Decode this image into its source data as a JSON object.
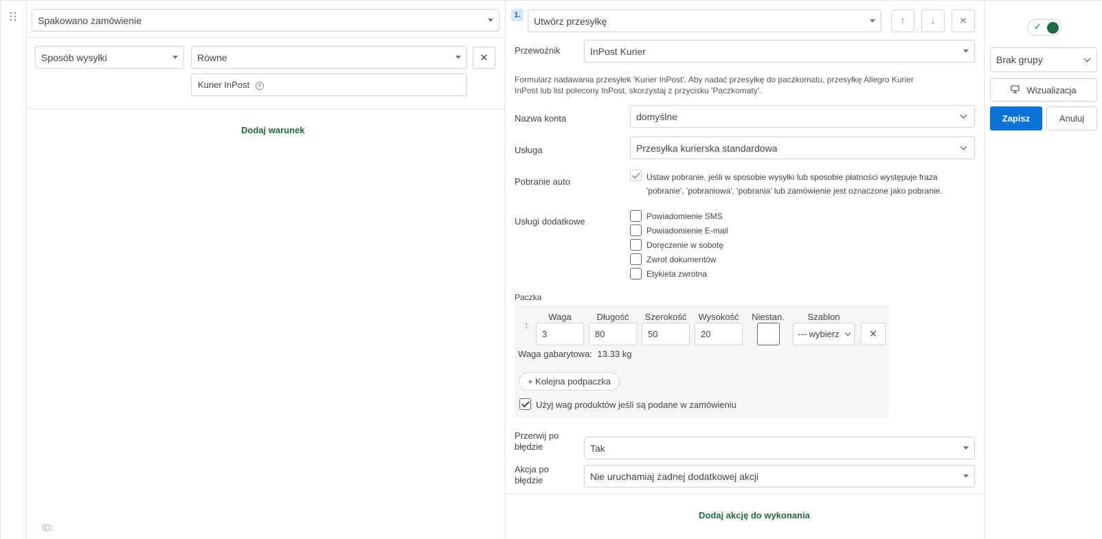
{
  "left": {
    "trigger_select": "Spakowano zamówienie",
    "condition": {
      "field_select": "Sposób wysyłki",
      "operator_select": "Równe",
      "tag": "Kurier InPost"
    },
    "add_condition_link": "Dodaj warunek",
    "id_label": "ID:"
  },
  "action": {
    "number_badge": "1.",
    "action_select": "Utwórz przesyłkę",
    "carrier_label": "Przewoźnik",
    "carrier_select": "InPost Kurier",
    "info_text_line1": "Formularz nadawania przesyłek 'Kurier InPost'. Aby nadać przesyłkę do paczkomatu, przesyłkę Allegro Kurier",
    "info_text_line2": "InPost lub list polecony InPost, skorzystaj z przycisku 'Paczkomaty'.",
    "account_label": "Nazwa konta",
    "account_select": "domyślne",
    "service_label": "Usługa",
    "service_select": "Przesyłka kurierska standardowa",
    "cod_label": "Pobranie auto",
    "cod_text_line1": "Ustaw pobranie, jeśli w sposobie wysyłki lub sposobie płatności występuje fraza",
    "cod_text_line2": "'pobranie', 'pobraniowa', 'pobrania' lub zamówienie jest oznaczone jako pobranie.",
    "extra_label": "Usługi dodatkowe",
    "extras": [
      "Powiadomienie SMS",
      "Powiadomienie E-mail",
      "Doręczenie w sobotę",
      "Zwrot dokumentów",
      "Etykieta zwrotna"
    ],
    "package_label": "Paczka",
    "package": {
      "row_number": "1",
      "headers": {
        "weight": "Waga",
        "length": "Długość",
        "width": "Szerokość",
        "height": "Wysokość",
        "nonstd": "Niestan.",
        "template": "Szablon"
      },
      "weight": "3",
      "length": "80",
      "width": "50",
      "height": "20",
      "template_select": "--- wybierz",
      "dim_weight_label": "Waga gabarytowa:",
      "dim_weight_value": "13.33 kg",
      "add_subpackage": "+ Kolejna podpaczka",
      "use_weights_label": "Użyj wag produktów jeśli są podane w zamówieniu"
    },
    "stop_on_error_label_line1": "Przerwij po",
    "stop_on_error_label_line2": "błędzie",
    "stop_on_error_select": "Tak",
    "action_on_error_label_line1": "Akcja po",
    "action_on_error_label_line2": "błędzie",
    "action_on_error_select": "Nie uruchamiaj żadnej dodatkowej akcji",
    "add_action_link": "Dodaj akcję do wykonania"
  },
  "right": {
    "group_select": "Brak grupy",
    "visualize_button": "Wizualizacja",
    "save_button": "Zapisz",
    "cancel_button": "Anuluj"
  },
  "colors": {
    "accent_blue": "#0a73d9",
    "link_green": "#1d6b3f",
    "toggle_green": "#1a6b45"
  }
}
